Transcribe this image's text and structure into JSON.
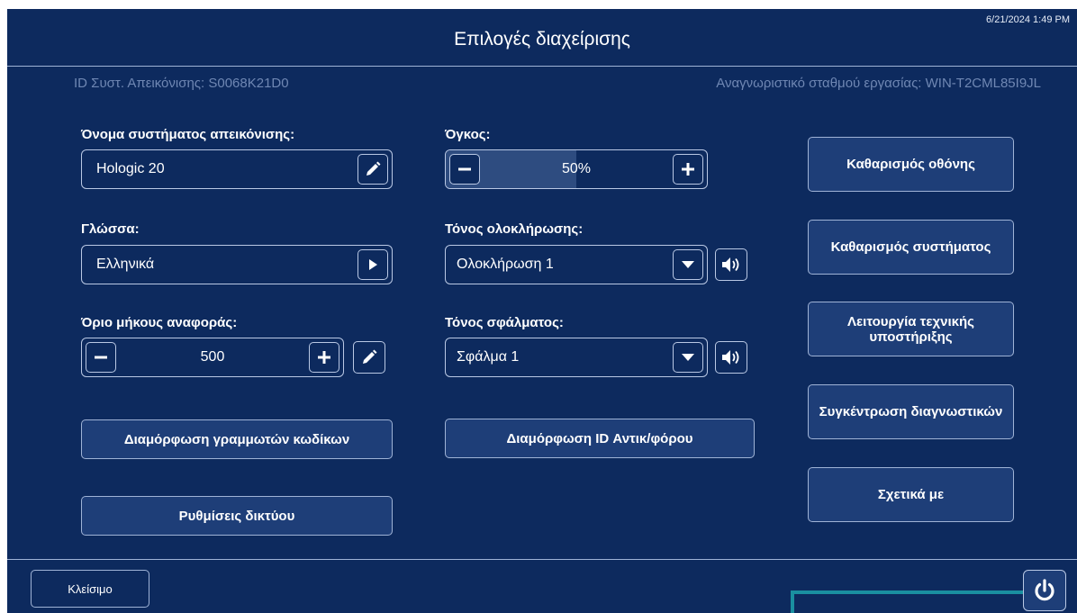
{
  "header": {
    "datetime": "6/21/2024 1:49 PM",
    "title": "Επιλογές διαχείρισης",
    "system_id": "ID Συστ. Απεικόνισης: S0068K21D0",
    "workstation_id": "Αναγνωριστικό σταθμού εργασίας: WIN-T2CML85I9JL"
  },
  "system_name": {
    "label": "Όνομα συστήματος απεικόνισης:",
    "value": "Hologic 20",
    "icon": "pencil-icon"
  },
  "language": {
    "label": "Γλώσσα:",
    "value": "Ελληνικά",
    "icon": "play-right-icon"
  },
  "report_length": {
    "label": "Όριο μήκους αναφοράς:",
    "value": "500"
  },
  "volume": {
    "label": "Όγκος:",
    "value": "50%",
    "level_fraction": 0.5
  },
  "completion_tone": {
    "label": "Τόνος ολοκλήρωσης:",
    "value": "Ολοκλήρωση 1"
  },
  "error_tone": {
    "label": "Τόνος σφάλματος:",
    "value": "Σφάλμα 1"
  },
  "buttons": {
    "barcode": "Διαμόρφωση γραμμωτών κωδίκων",
    "network": "Ρυθμίσεις δικτύου",
    "accession": "Διαμόρφωση ID Αντικ/φόρου",
    "clear_screen": "Καθαρισμός οθόνης",
    "clear_system": "Καθαρισμός συστήματος",
    "tech_support": "Λειτουργία τεχνικής υποστήριξης",
    "diagnostics": "Συγκέντρωση διαγνωστικών",
    "about": "Σχετικά με",
    "close": "Κλείσιμο"
  },
  "colors": {
    "background": "#0d2a5e",
    "button": "#1e3e78",
    "accent_line": "#1a8fa0"
  }
}
